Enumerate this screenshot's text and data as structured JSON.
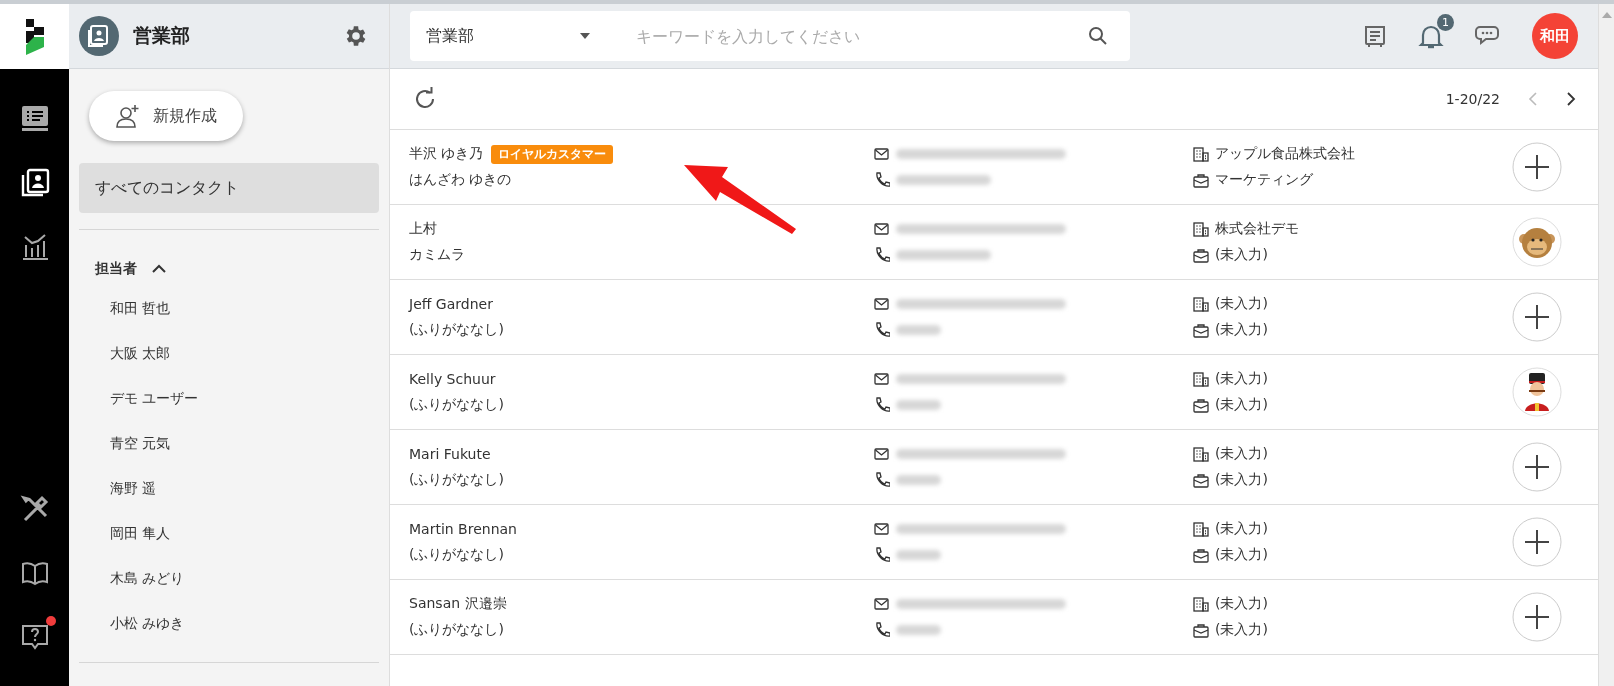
{
  "rail": {
    "items": [
      {
        "kind": "list",
        "selected": false
      },
      {
        "kind": "contacts",
        "selected": true
      },
      {
        "kind": "chart",
        "selected": false
      },
      {
        "kind": "tools",
        "selected": false
      },
      {
        "kind": "book",
        "selected": false
      },
      {
        "kind": "help",
        "selected": false,
        "notify": true
      }
    ]
  },
  "sidebar": {
    "title": "営業部",
    "new_button": "新規作成",
    "all_contacts": {
      "label": "すべてのコンタクト",
      "selected": true
    },
    "section": {
      "label": "担当者",
      "expanded": true
    },
    "owners": [
      "和田 哲也",
      "大阪 太郎",
      "デモ ユーザー",
      "青空 元気",
      "海野 遥",
      "岡田 隼人",
      "木島 みどり",
      "小松 みゆき"
    ]
  },
  "topbar": {
    "scope": "営業部",
    "search_placeholder": "キーワードを入力してください",
    "notification_count": "1",
    "user": "和田"
  },
  "list": {
    "pagination": "1-20/22",
    "rows": [
      {
        "name": "半沢 ゆき乃",
        "tag": "ロイヤルカスタマー",
        "furigana": "はんざわ ゆきの",
        "company": "アップル食品株式会社",
        "department": "マーケティング",
        "kind": "add"
      },
      {
        "name": "上村",
        "furigana": "カミムラ",
        "company": "株式会社デモ",
        "department": "(未入力)",
        "kind": "monkey"
      },
      {
        "name": "Jeff Gardner",
        "furigana": "(ふりがななし)",
        "company": "(未入力)",
        "department": "(未入力)",
        "kind": "add"
      },
      {
        "name": "Kelly Schuur",
        "furigana": "(ふりがななし)",
        "company": "(未入力)",
        "department": "(未入力)",
        "kind": "guard"
      },
      {
        "name": "Mari Fukute",
        "furigana": "(ふりがななし)",
        "company": "(未入力)",
        "department": "(未入力)",
        "kind": "add"
      },
      {
        "name": "Martin Brennan",
        "furigana": "(ふりがななし)",
        "company": "(未入力)",
        "department": "(未入力)",
        "kind": "add"
      },
      {
        "name": "Sansan 沢邉崇",
        "furigana": "(ふりがななし)",
        "company": "(未入力)",
        "department": "(未入力)",
        "kind": "add"
      }
    ]
  }
}
